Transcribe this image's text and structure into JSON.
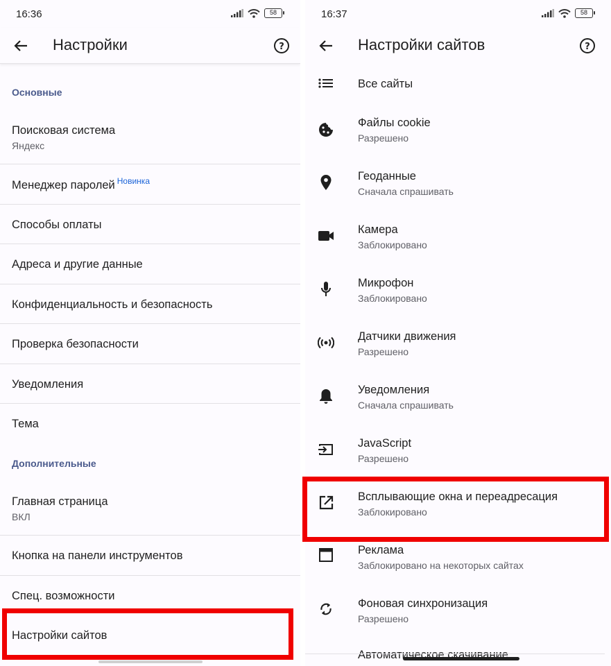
{
  "left": {
    "status_time": "16:36",
    "battery": "58",
    "title": "Настройки",
    "section_basic": "Основные",
    "items": [
      {
        "title": "Поисковая система",
        "subtitle": "Яндекс"
      },
      {
        "title": "Менеджер паролей",
        "badge": "Новинка"
      },
      {
        "title": "Способы оплаты"
      },
      {
        "title": "Адреса и другие данные"
      },
      {
        "title": "Конфиденциальность и безопасность"
      },
      {
        "title": "Проверка безопасности"
      },
      {
        "title": "Уведомления"
      },
      {
        "title": "Тема"
      }
    ],
    "section_advanced": "Дополнительные",
    "advanced_items": [
      {
        "title": "Главная страница",
        "subtitle": "ВКЛ"
      },
      {
        "title": "Кнопка на панели инструментов"
      },
      {
        "title": "Спец. возможности"
      },
      {
        "title": "Настройки сайтов"
      }
    ]
  },
  "right": {
    "status_time": "16:37",
    "battery": "58",
    "title": "Настройки сайтов",
    "items": [
      {
        "title": "Все сайты",
        "icon": "list-icon"
      },
      {
        "title": "Файлы cookie",
        "subtitle": "Разрешено",
        "icon": "cookie-icon"
      },
      {
        "title": "Геоданные",
        "subtitle": "Сначала спрашивать",
        "icon": "location-pin-icon"
      },
      {
        "title": "Камера",
        "subtitle": "Заблокировано",
        "icon": "camera-icon"
      },
      {
        "title": "Микрофон",
        "subtitle": "Заблокировано",
        "icon": "microphone-icon"
      },
      {
        "title": "Датчики движения",
        "subtitle": "Разрешено",
        "icon": "motion-sensor-icon"
      },
      {
        "title": "Уведомления",
        "subtitle": "Сначала спрашивать",
        "icon": "bell-icon"
      },
      {
        "title": "JavaScript",
        "subtitle": "Разрешено",
        "icon": "javascript-icon"
      },
      {
        "title": "Всплывающие окна и переадресация",
        "subtitle": "Заблокировано",
        "icon": "popup-icon"
      },
      {
        "title": "Реклама",
        "subtitle": "Заблокировано на некоторых сайтах",
        "icon": "ads-window-icon"
      },
      {
        "title": "Фоновая синхронизация",
        "subtitle": "Разрешено",
        "icon": "sync-icon"
      }
    ],
    "cut_item": "Автоматическое скачивание"
  },
  "colors": {
    "highlight": "#f00000",
    "section_header": "#4a5a8c",
    "badge": "#1a63d8",
    "background": "#fdfbff"
  }
}
